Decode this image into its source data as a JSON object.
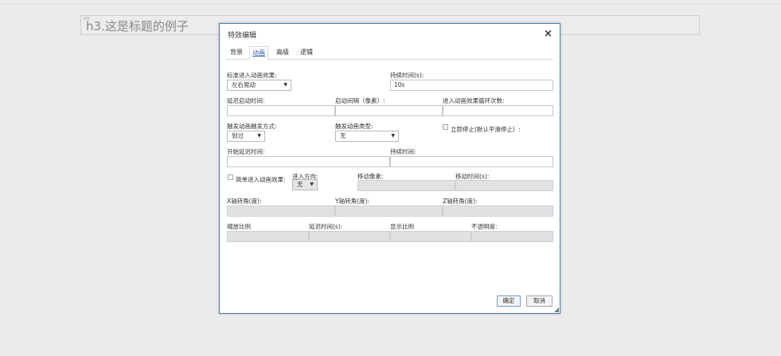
{
  "page": {
    "heading_tag": "H3",
    "heading_text": "h3.这是标题的例子"
  },
  "dialog": {
    "title": "特效编辑",
    "close_glyph": "×",
    "tabs": [
      "背景",
      "动画",
      "高级",
      "逻辑"
    ],
    "active_tab": "动画",
    "fields": {
      "std_effect_label": "标准进入动画效果:",
      "std_effect_value": "左右晃动",
      "duration_label": "持续时间(s):",
      "duration_value": "10s",
      "delay_label": "延迟启动时间:",
      "interval_label": "启动间隔（像素）:",
      "loop_label": "进入动画效果循环次数:",
      "trigger_mode_label": "触发动画触发方式:",
      "trigger_mode_value": "划过",
      "trigger_type_label": "触发动画类型:",
      "trigger_type_value": "无",
      "stop_label": "立即停止(默认平滑停止）:",
      "start_delay_label": "开始延迟时间:",
      "duration2_label": "持续时间:",
      "simple_effect_label": "简单进入动画效果:",
      "direction_label": "进入方向:",
      "direction_value": "无",
      "move_px_label": "移动像素:",
      "move_time_label": "移动时间(s):",
      "x_rot_label": "X轴转角(度):",
      "y_rot_label": "Y轴转角(度):",
      "z_rot_label": "Z轴转角(度):",
      "scale_label": "缩放比例",
      "delay_time_label": "延迟时间(s):",
      "display_ratio_label": "显示比例",
      "opacity_label": "不透明度:"
    },
    "buttons": {
      "ok": "确定",
      "cancel": "取消"
    }
  },
  "dropdown_glyph": "▼"
}
